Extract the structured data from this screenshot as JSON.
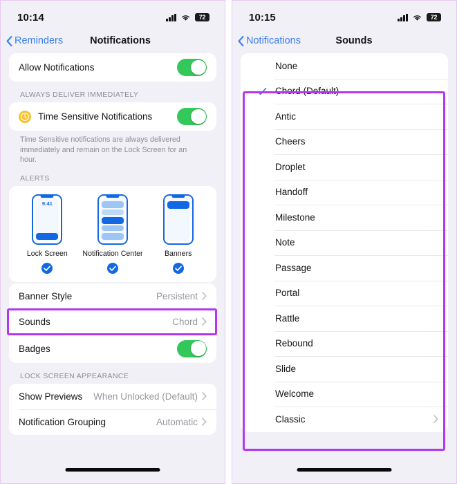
{
  "left_panel": {
    "status_bar": {
      "time": "10:14",
      "battery": "72",
      "signal_icon": "cellular-signal-icon",
      "wifi_icon": "wifi-icon",
      "battery_icon": "battery-icon"
    },
    "nav": {
      "back_label": "Reminders",
      "title": "Notifications",
      "back_icon": "chevron-left-icon"
    },
    "allow_notifications": {
      "label": "Allow Notifications",
      "enabled": true
    },
    "always_deliver_header": "ALWAYS DELIVER IMMEDIATELY",
    "time_sensitive": {
      "label": "Time Sensitive Notifications",
      "enabled": true,
      "icon": "clock-icon"
    },
    "time_sensitive_footnote": "Time Sensitive notifications are always delivered immediately and remain on the Lock Screen for an hour.",
    "alerts_header": "ALERTS",
    "alerts": [
      {
        "caption": "Lock Screen",
        "selected": true,
        "mock_time": "9:41"
      },
      {
        "caption": "Notification Center",
        "selected": true
      },
      {
        "caption": "Banners",
        "selected": true
      }
    ],
    "settings_rows": [
      {
        "label": "Banner Style",
        "value": "Persistent"
      },
      {
        "label": "Sounds",
        "value": "Chord"
      }
    ],
    "badges": {
      "label": "Badges",
      "enabled": true
    },
    "lock_screen_header": "LOCK SCREEN APPEARANCE",
    "lock_screen_rows": [
      {
        "label": "Show Previews",
        "value": "When Unlocked (Default)"
      },
      {
        "label": "Notification Grouping",
        "value": "Automatic"
      }
    ]
  },
  "right_panel": {
    "status_bar": {
      "time": "10:15",
      "battery": "72"
    },
    "nav": {
      "back_label": "Notifications",
      "title": "Sounds",
      "back_icon": "chevron-left-icon"
    },
    "sounds": [
      {
        "name": "None",
        "checked": false,
        "chevron": false
      },
      {
        "name": "Chord (Default)",
        "checked": true,
        "chevron": false
      },
      {
        "name": "Antic",
        "checked": false,
        "chevron": false
      },
      {
        "name": "Cheers",
        "checked": false,
        "chevron": false
      },
      {
        "name": "Droplet",
        "checked": false,
        "chevron": false
      },
      {
        "name": "Handoff",
        "checked": false,
        "chevron": false
      },
      {
        "name": "Milestone",
        "checked": false,
        "chevron": false
      },
      {
        "name": "Note",
        "checked": false,
        "chevron": false
      },
      {
        "name": "Passage",
        "checked": false,
        "chevron": false
      },
      {
        "name": "Portal",
        "checked": false,
        "chevron": false
      },
      {
        "name": "Rattle",
        "checked": false,
        "chevron": false
      },
      {
        "name": "Rebound",
        "checked": false,
        "chevron": false
      },
      {
        "name": "Slide",
        "checked": false,
        "chevron": false
      },
      {
        "name": "Welcome",
        "checked": false,
        "chevron": false
      },
      {
        "name": "Classic",
        "checked": false,
        "chevron": true
      }
    ]
  },
  "annotations": {
    "highlight_color": "#b536f0",
    "accent_blue": "#3a7ff0",
    "toggle_green": "#34c759"
  }
}
